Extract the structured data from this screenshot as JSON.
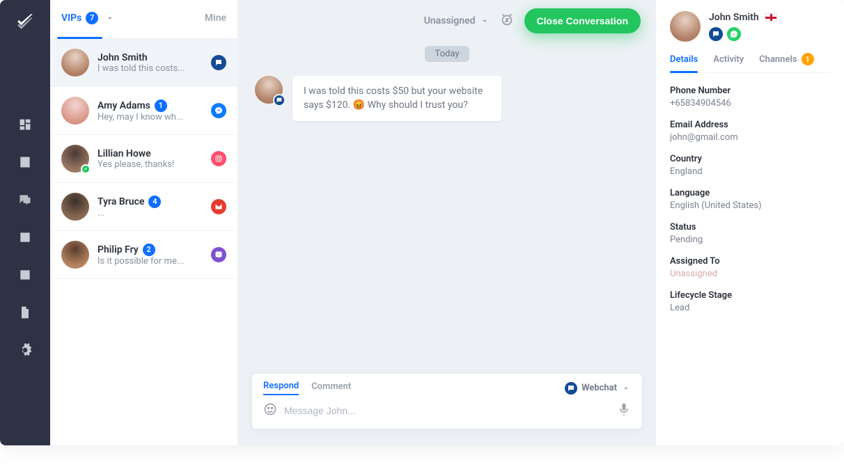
{
  "rail": {
    "icons": [
      "dashboard",
      "contacts",
      "chat",
      "list",
      "analytics",
      "file",
      "settings"
    ]
  },
  "tabs": {
    "primary_label": "VIPs",
    "primary_count": "7",
    "secondary_label": "Mine"
  },
  "conversations": [
    {
      "name": "John Smith",
      "preview": "I was told this costs...",
      "channel": "webchat",
      "active": true,
      "badge": ""
    },
    {
      "name": "Amy Adams",
      "preview": "Hey, may I know wh...",
      "channel": "messenger",
      "active": false,
      "badge": "1"
    },
    {
      "name": "Lillian Howe",
      "preview": "Yes please, thanks!",
      "channel": "instagram",
      "active": false,
      "badge": "",
      "status": "check"
    },
    {
      "name": "Tyra Bruce",
      "preview": "...",
      "channel": "gmail",
      "active": false,
      "badge": "4"
    },
    {
      "name": "Philip Fry",
      "preview": "Is it possible for me...",
      "channel": "viber",
      "active": false,
      "badge": "2"
    }
  ],
  "header": {
    "assign_label": "Unassigned",
    "close_label": "Close Conversation"
  },
  "thread": {
    "day_label": "Today",
    "message": "I was told this costs $50 but your website says $120. 😡 Why should I trust you?"
  },
  "composer": {
    "respond_label": "Respond",
    "comment_label": "Comment",
    "channel_label": "Webchat",
    "placeholder": "Message John..."
  },
  "contact": {
    "name": "John Smith",
    "tabs": {
      "details": "Details",
      "activity": "Activity",
      "channels": "Channels",
      "channels_badge": "1"
    },
    "fields": [
      {
        "label": "Phone Number",
        "value": "+65834904546"
      },
      {
        "label": "Email Address",
        "value": "john@gmail.com"
      },
      {
        "label": "Country",
        "value": "England"
      },
      {
        "label": "Language",
        "value": "English (United States)"
      },
      {
        "label": "Status",
        "value": "Pending"
      },
      {
        "label": "Assigned To",
        "value": "Unassigned",
        "muted": true
      },
      {
        "label": "Lifecycle Stage",
        "value": "Lead"
      }
    ]
  },
  "avatar_colors": {
    "John Smith": [
      "#e8d2c4",
      "#b07e63"
    ],
    "Amy Adams": [
      "#f2d6d2",
      "#d99487"
    ],
    "Lillian Howe": [
      "#4d3a34",
      "#997764"
    ],
    "Tyra Bruce": [
      "#3a2f29",
      "#8a6a53"
    ],
    "Philip Fry": [
      "#5a3c2e",
      "#b58560"
    ]
  }
}
